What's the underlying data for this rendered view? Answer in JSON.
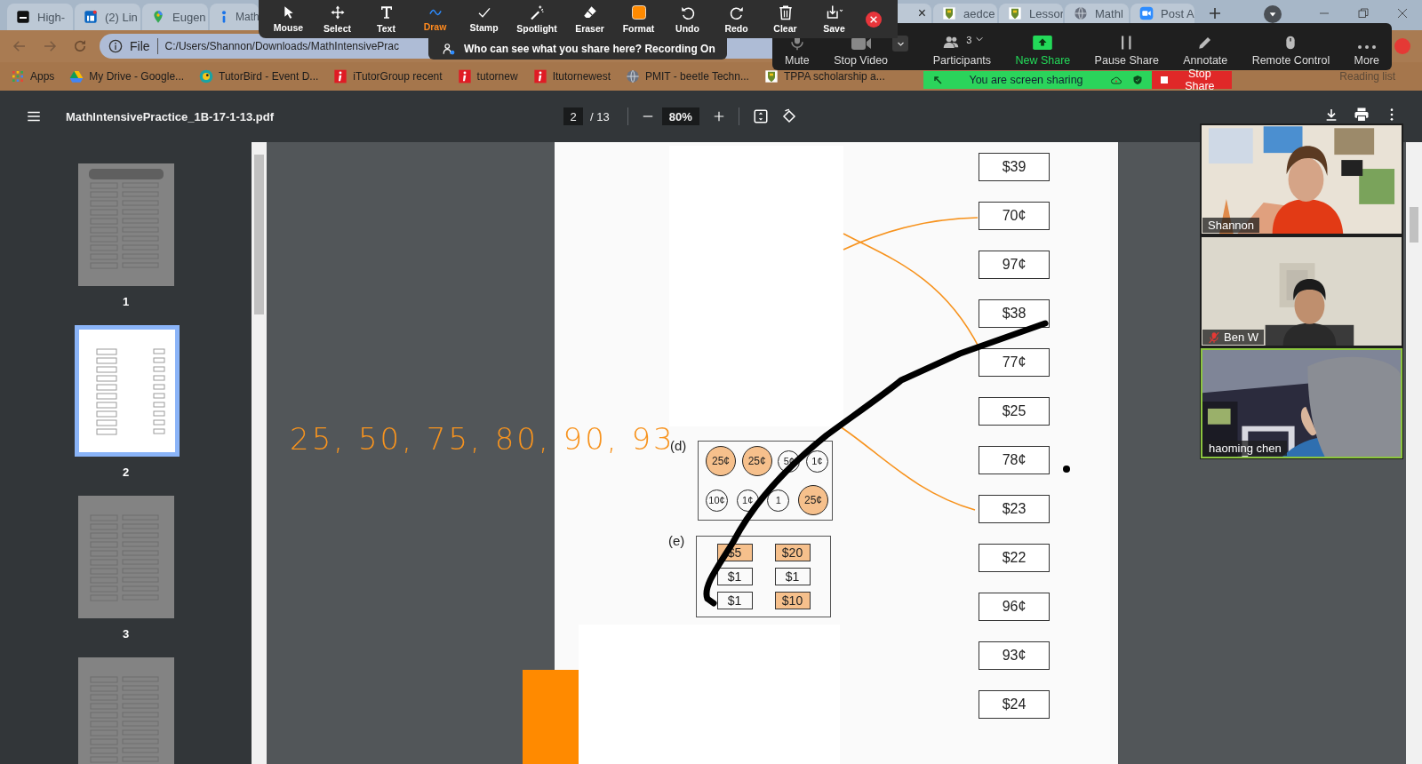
{
  "browser": {
    "tabs": [
      {
        "label": "High-",
        "kind": "ae"
      },
      {
        "label": "(2) Lin",
        "kind": "linkedin"
      },
      {
        "label": "Eugen",
        "kind": "maps"
      },
      {
        "label": "Math",
        "kind": "itutor"
      }
    ],
    "tab_close": "×",
    "right_tabs": [
      {
        "label": "aedce",
        "kind": "crest"
      },
      {
        "label": "Lessor",
        "kind": "crest"
      },
      {
        "label": "Mathl",
        "kind": "globe"
      },
      {
        "label": "Post A",
        "kind": "zoom"
      }
    ],
    "address": {
      "scheme": "File",
      "url": "C:/Users/Shannon/Downloads/MathIntensivePrac"
    },
    "bookmarks": [
      {
        "label": "Apps",
        "kind": "apps"
      },
      {
        "label": "My Drive - Google...",
        "kind": "drive"
      },
      {
        "label": "TutorBird - Event D...",
        "kind": "bird"
      },
      {
        "label": "iTutorGroup recent",
        "kind": "itutor"
      },
      {
        "label": "tutornew",
        "kind": "itutor"
      },
      {
        "label": "Itutornewest",
        "kind": "itutor"
      },
      {
        "label": "PMIT - beetle Techn...",
        "kind": "globe"
      },
      {
        "label": "TPPA scholarship a...",
        "kind": "crest"
      }
    ],
    "reading_list": "Reading list"
  },
  "annotate_toolbar": {
    "tools": [
      {
        "label": "Mouse",
        "kind": "mouse",
        "selected": false
      },
      {
        "label": "Select",
        "kind": "select",
        "selected": false
      },
      {
        "label": "Text",
        "kind": "text",
        "selected": false
      },
      {
        "label": "Draw",
        "kind": "draw",
        "selected": true
      },
      {
        "label": "Stamp",
        "kind": "stamp",
        "selected": false
      },
      {
        "label": "Spotlight",
        "kind": "spotlight",
        "selected": false
      },
      {
        "label": "Eraser",
        "kind": "eraser",
        "selected": false
      },
      {
        "label": "Format",
        "kind": "format",
        "selected": false
      },
      {
        "label": "Undo",
        "kind": "undo",
        "selected": false
      },
      {
        "label": "Redo",
        "kind": "redo",
        "selected": false
      },
      {
        "label": "Clear",
        "kind": "clear",
        "selected": false
      },
      {
        "label": "Save",
        "kind": "save",
        "selected": false
      }
    ],
    "share_notice": "Who can see what you share here? Recording On"
  },
  "meeting_controls": [
    {
      "label": "Mute",
      "kind": "mute"
    },
    {
      "label": "Stop Video",
      "kind": "video"
    },
    {
      "label": "Participants",
      "kind": "participants",
      "count": "3"
    },
    {
      "label": "New Share",
      "kind": "share"
    },
    {
      "label": "Pause Share",
      "kind": "pause"
    },
    {
      "label": "Annotate",
      "kind": "annotate"
    },
    {
      "label": "Remote Control",
      "kind": "remote"
    },
    {
      "label": "More",
      "kind": "more"
    }
  ],
  "sharing_bar": {
    "status": "You are screen sharing",
    "stop": "Stop Share"
  },
  "pdf_toolbar": {
    "title": "MathIntensivePractice_1B-17-1-13.pdf",
    "page": "2",
    "total": "/ 13",
    "zoom": "80%"
  },
  "thumbnails": [
    {
      "label": "1",
      "selected": false
    },
    {
      "label": "2",
      "selected": true
    },
    {
      "label": "3",
      "selected": false
    },
    {
      "selected": false
    }
  ],
  "worksheet": {
    "handwriting": "25, 50, 75, 80, 90, 93",
    "coin_label": "(d)",
    "coin_rows": [
      {
        "coins": [
          {
            "label": "25¢",
            "highlighted": true
          },
          {
            "label": "25¢",
            "highlighted": true
          },
          {
            "label": "5¢",
            "highlighted": false
          },
          {
            "label": "1¢",
            "highlighted": false
          }
        ]
      },
      {
        "coins": [
          {
            "label": "10¢",
            "highlighted": false
          },
          {
            "label": "1¢",
            "highlighted": false
          },
          {
            "label": "1",
            "highlighted": false
          },
          {
            "label": "25¢",
            "highlighted": true
          }
        ]
      }
    ],
    "bill_label": "(e)",
    "bills": [
      {
        "label": "$5",
        "highlighted": true
      },
      {
        "label": "$20",
        "highlighted": true
      },
      {
        "label": "$1",
        "highlighted": false
      },
      {
        "label": "$1",
        "highlighted": false
      },
      {
        "label": "$1",
        "highlighted": false
      },
      {
        "label": "$10",
        "highlighted": true
      }
    ],
    "answers": [
      "$39",
      "70¢",
      "97¢",
      "$38",
      "77¢",
      "$25",
      "78¢",
      "$23",
      "$22",
      "96¢",
      "93¢",
      "$24"
    ]
  },
  "participants": [
    {
      "name": "Shannon",
      "muted": false,
      "speaking": false
    },
    {
      "name": "Ben W",
      "muted": true,
      "speaking": false
    },
    {
      "name": "haoming chen",
      "muted": false,
      "speaking": true
    }
  ]
}
